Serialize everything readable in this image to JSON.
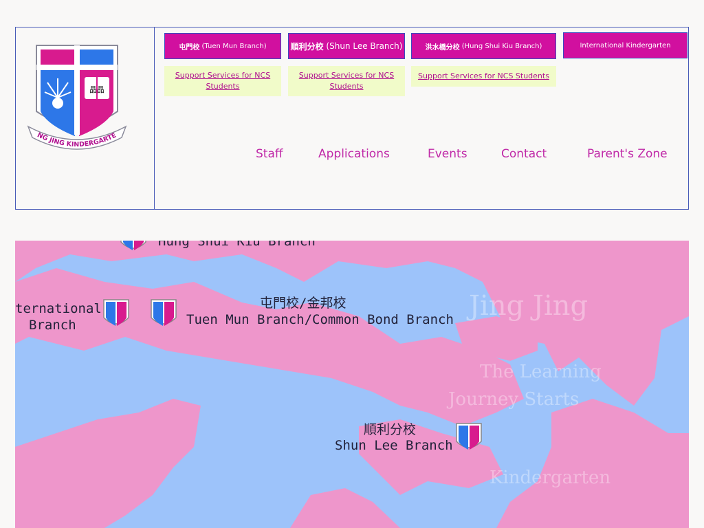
{
  "header": {
    "branches": [
      {
        "zh": "屯門校",
        "en": "(Tuen Mun Branch)"
      },
      {
        "zh": "順利分校",
        "en": "(Shun Lee Branch)"
      },
      {
        "zh": "洪水橋分校",
        "en": "(Hung Shui Kiu Branch)"
      },
      {
        "zh": "",
        "en": "International Kindergarten"
      }
    ],
    "ncs_links": [
      "Support Services for NCS Students",
      "Support Services for NCS Students",
      "Support Services for NCS Students"
    ],
    "nav": [
      "Staff",
      "Applications",
      "Events",
      "Contact",
      "Parent's Zone"
    ]
  },
  "logo": {
    "ribbon_text": "JING JING KINDERGARTEN",
    "book_text": "晶晶"
  },
  "map": {
    "labels": {
      "hsk": "Hung Shui Kiu Branch",
      "intl_1": "ternational",
      "intl_2": "Branch",
      "tm_zh": "屯門校/金邦校",
      "tm_en": "Tuen Mun Branch/Common Bond Branch",
      "sl_zh": "順利分校",
      "sl_en": "Shun Lee Branch",
      "watermark_1": "Jing Jing",
      "watermark_2": "The Learning",
      "watermark_3": "Journey Starts",
      "watermark_4": "Kindergarten"
    },
    "colors": {
      "land": "#ee96cb",
      "sea": "#9dc3fa"
    }
  },
  "colors": {
    "accent": "#d1109f",
    "border": "#4a5cb8",
    "nav": "#c02aa8",
    "ncs_bg": "#f1fbc9"
  }
}
